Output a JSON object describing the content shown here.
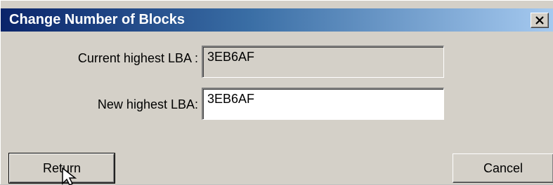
{
  "window": {
    "title": "Change Number of Blocks",
    "close_icon": "close-icon"
  },
  "form": {
    "current_label": "Current highest LBA :",
    "current_value": "3EB6AF",
    "new_label": "New highest LBA:",
    "new_value": "3EB6AF"
  },
  "buttons": {
    "return_label": "Return",
    "cancel_label": "Cancel"
  },
  "cursor_icon": "mouse-pointer-icon",
  "colors": {
    "titlebar_start": "#0a246a",
    "titlebar_end": "#a6caf0",
    "face": "#d4d0c8"
  }
}
